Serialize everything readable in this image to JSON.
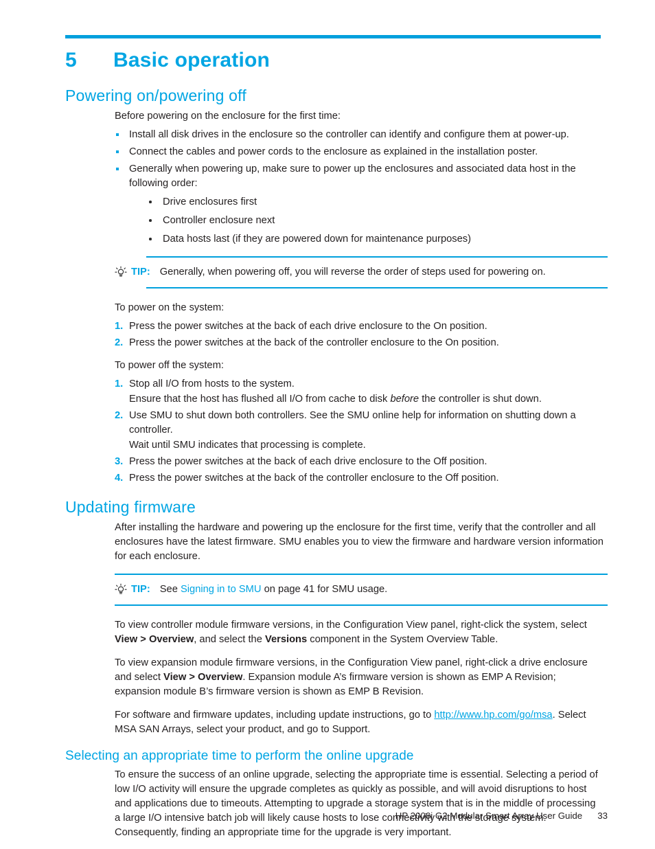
{
  "colors": {
    "accent": "#00a5e3",
    "rule": "#00a0dd",
    "text": "#231f20"
  },
  "chapter": {
    "number": "5",
    "title": "Basic operation"
  },
  "sections": {
    "powering": {
      "heading": "Powering on/powering off",
      "intro": "Before powering on the enclosure for the first time:",
      "bullets": [
        "Install all disk drives in the enclosure so the controller can identify and configure them at power-up.",
        "Connect the cables and power cords to the enclosure as explained in the installation poster.",
        "Generally when powering up, make sure to power up the enclosures and associated data host in the following order:"
      ],
      "subbullets": [
        "Drive enclosures first",
        "Controller enclosure next",
        "Data hosts last (if they are powered down for maintenance purposes)"
      ],
      "tip": {
        "label": "TIP:",
        "text": "Generally, when powering off, you will reverse the order of steps used for powering on."
      },
      "power_on_intro": "To power on the system:",
      "power_on_steps": [
        {
          "num": "1.",
          "text": "Press the power switches at the back of each drive enclosure to the On position."
        },
        {
          "num": "2.",
          "text": "Press the power switches at the back of the controller enclosure to the On position."
        }
      ],
      "power_off_intro": "To power off the system:",
      "power_off_steps": [
        {
          "num": "1.",
          "text": "Stop all I/O from hosts to the system.",
          "sub_pre": "Ensure that the host has flushed all I/O from cache to disk ",
          "sub_em": "before",
          "sub_post": " the controller is shut down."
        },
        {
          "num": "2.",
          "text": "Use SMU to shut down both controllers. See the SMU online help for information on shutting down a controller.",
          "sub_pre": "Wait until SMU indicates that processing is complete.",
          "sub_em": "",
          "sub_post": ""
        },
        {
          "num": "3.",
          "text": "Press the power switches at the back of each drive enclosure to the Off position."
        },
        {
          "num": "4.",
          "text": "Press the power switches at the back of the controller enclosure to the Off position."
        }
      ]
    },
    "firmware": {
      "heading": "Updating firmware",
      "intro": "After installing the hardware and powering up the enclosure for the first time, verify that the controller and all enclosures have the latest firmware. SMU enables you to view the firmware and hardware version information for each enclosure.",
      "tip": {
        "label": "TIP:",
        "prefix": "See ",
        "link": "Signing in to SMU",
        "suffix": " on page 41 for SMU usage."
      },
      "para_controller": {
        "p1": "To view controller module firmware versions, in the Configuration View panel, right-click the system, select ",
        "b1": "View > Overview",
        "p2": ", and select the ",
        "b2": "Versions",
        "p3": " component in the System Overview Table."
      },
      "para_expansion": {
        "p1": "To view expansion module firmware versions, in the Configuration View panel, right-click a drive enclosure and select ",
        "b1": "View > Overview",
        "p2": ". Expansion module A’s firmware version is shown as EMP A Revision; expansion module B’s firmware version is shown as EMP B Revision."
      },
      "para_updates": {
        "p1": "For software and firmware updates, including update instructions, go to ",
        "url": "http://www.hp.com/go/msa",
        "p2": ". Select MSA SAN Arrays, select your product, and go to Support."
      }
    },
    "upgrade_time": {
      "heading": "Selecting an appropriate time to perform the online upgrade",
      "body": "To ensure the success of an online upgrade, selecting the appropriate time is essential. Selecting a period of low I/O activity will ensure the upgrade completes as quickly as possible, and will avoid disruptions to host and applications due to timeouts. Attempting to upgrade a storage system that is in the middle of processing a large I/O intensive batch job will likely cause hosts to lose connectivity with the storage system. Consequently, finding an appropriate time for the upgrade is very important."
    }
  },
  "footer": {
    "title": "HP 2000i G2 Modular Smart Array User Guide",
    "page": "33"
  }
}
